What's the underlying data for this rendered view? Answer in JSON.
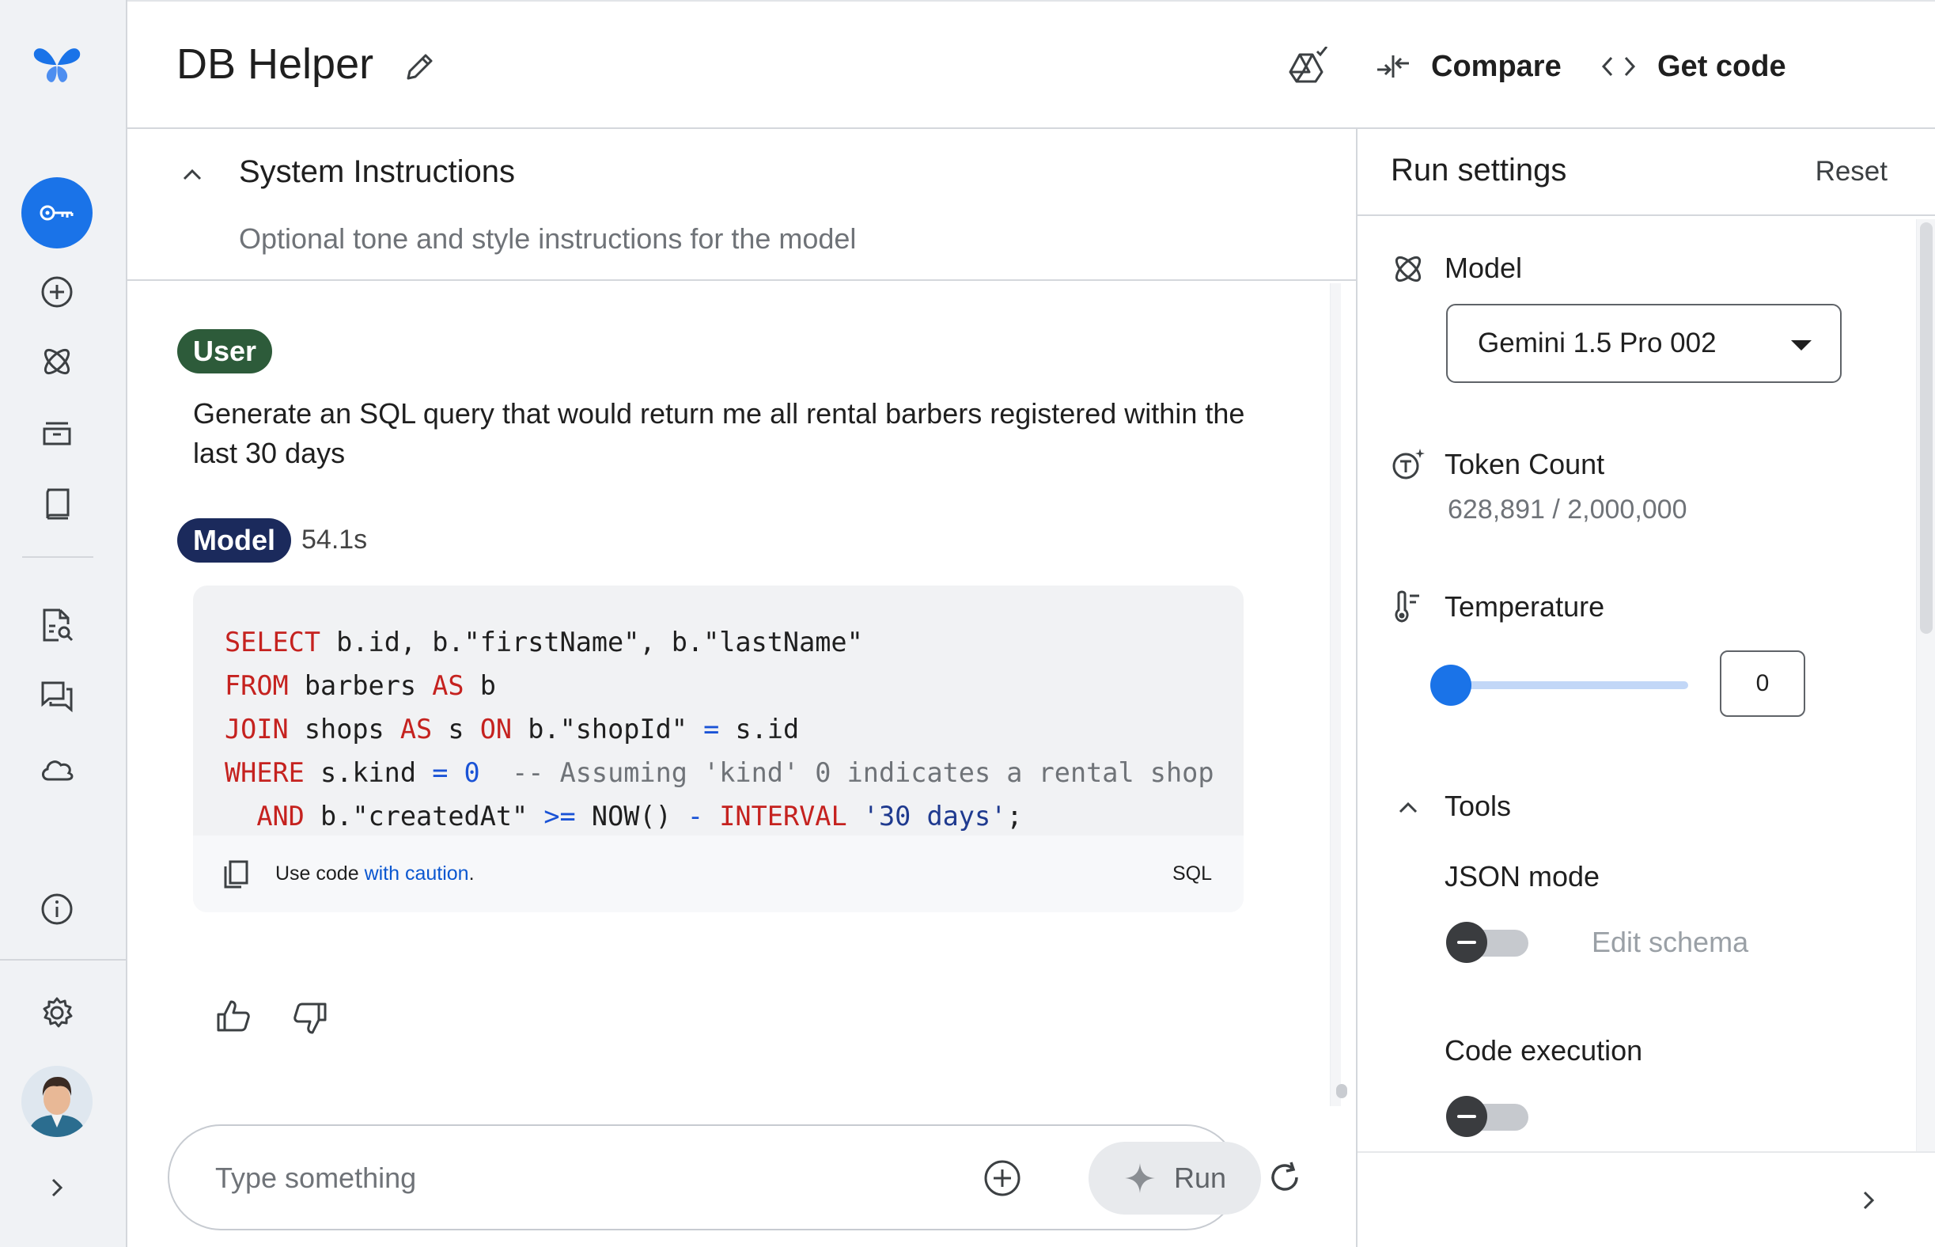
{
  "app": {
    "title": "DB Helper"
  },
  "header": {
    "compare_label": "Compare",
    "get_code_label": "Get code"
  },
  "system_instructions": {
    "title": "System Instructions",
    "placeholder": "Optional tone and style instructions for the model"
  },
  "chat": {
    "user_role": "User",
    "user_message": "Generate an SQL query that would return me all rental barbers registered within the last 30 days",
    "model_role": "Model",
    "model_time": "54.1s",
    "code_caution_prefix": "Use code ",
    "code_caution_link": "with caution",
    "code_caution_suffix": ".",
    "code_language": "SQL"
  },
  "prompt": {
    "placeholder": "Type something",
    "run_label": "Run"
  },
  "run_settings": {
    "title": "Run settings",
    "reset_label": "Reset",
    "model_label": "Model",
    "model_value": "Gemini 1.5 Pro 002",
    "token_label": "Token Count",
    "token_value": "628,891 / 2,000,000",
    "temperature_label": "Temperature",
    "temperature_value": "0",
    "tools_label": "Tools",
    "json_mode_label": "JSON mode",
    "edit_schema_label": "Edit schema",
    "code_execution_label": "Code execution"
  },
  "colors": {
    "accent": "#1a73e8",
    "user_chip": "#2d5b3a",
    "model_chip": "#1b2a5c",
    "keyword": "#c5221f",
    "link": "#0b57d0"
  },
  "icons": [
    "gemini-logo",
    "key-icon",
    "add-circle-icon",
    "model-atom-icon",
    "archive-icon",
    "book-icon",
    "doc-search-icon",
    "chat-icon",
    "cloud-icon",
    "info-icon",
    "settings-icon",
    "avatar",
    "chevron-right-icon",
    "pencil-icon",
    "drive-save-icon",
    "compare-icon",
    "code-icon",
    "more-vert-icon",
    "chevron-up-icon",
    "copy-icon",
    "thumb-up-icon",
    "thumb-down-icon",
    "refresh-icon",
    "sparkle-icon",
    "token-icon",
    "thermometer-icon"
  ]
}
